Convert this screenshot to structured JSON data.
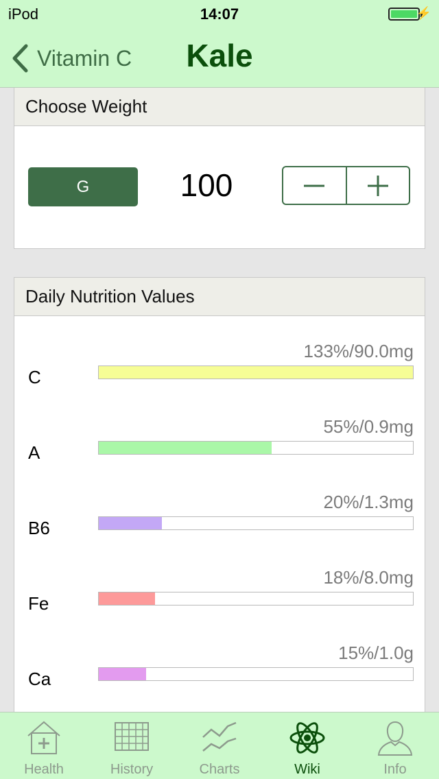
{
  "status_bar": {
    "carrier": "iPod",
    "time": "14:07"
  },
  "nav": {
    "back_label": "Vitamin C",
    "title": "Kale"
  },
  "weight": {
    "header": "Choose Weight",
    "unit": "G",
    "value": "100"
  },
  "nutrition": {
    "header": "Daily Nutrition Values",
    "items": [
      {
        "label": "C",
        "value_text": "133%/90.0mg",
        "percent": 133,
        "color": "#f6fd96"
      },
      {
        "label": "A",
        "value_text": "55%/0.9mg",
        "percent": 55,
        "color": "#aaf7a8"
      },
      {
        "label": "B6",
        "value_text": "20%/1.3mg",
        "percent": 20,
        "color": "#c3a8f6"
      },
      {
        "label": "Fe",
        "value_text": "18%/8.0mg",
        "percent": 18,
        "color": "#fd9a9a"
      },
      {
        "label": "Ca",
        "value_text": "15%/1.0g",
        "percent": 15,
        "color": "#e39bef"
      }
    ]
  },
  "tabs": [
    {
      "label": "Health",
      "icon": "health-icon",
      "active": false
    },
    {
      "label": "History",
      "icon": "history-icon",
      "active": false
    },
    {
      "label": "Charts",
      "icon": "charts-icon",
      "active": false
    },
    {
      "label": "Wiki",
      "icon": "wiki-icon",
      "active": true
    },
    {
      "label": "Info",
      "icon": "info-icon",
      "active": false
    }
  ],
  "colors": {
    "accent": "#3e6e48",
    "nav_background": "#ccf9cc",
    "title": "#0b4f0b"
  }
}
